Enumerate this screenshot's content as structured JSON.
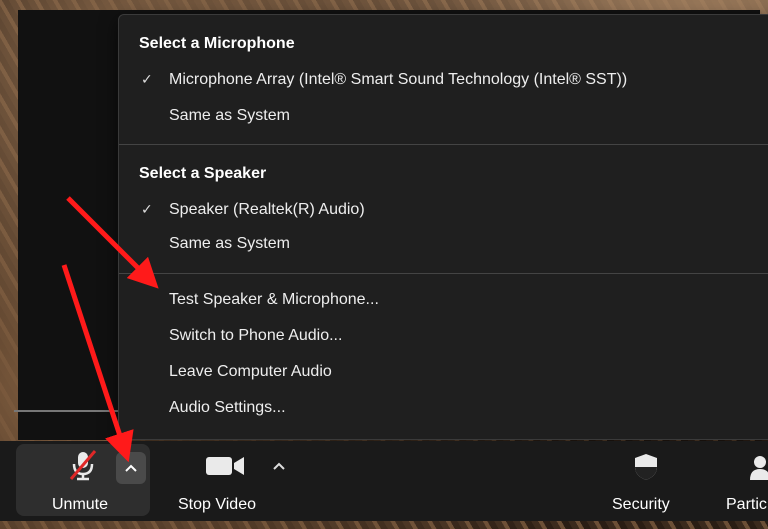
{
  "audio_menu": {
    "microphone_section": {
      "title": "Select a Microphone",
      "items": [
        {
          "label": "Microphone Array (Intel® Smart Sound Technology (Intel® SST))",
          "checked": true
        },
        {
          "label": "Same as System",
          "checked": false
        }
      ]
    },
    "speaker_section": {
      "title": "Select a Speaker",
      "items": [
        {
          "label": "Speaker (Realtek(R) Audio)",
          "checked": true
        },
        {
          "label": "Same as System",
          "checked": false
        }
      ]
    },
    "actions": [
      {
        "label": "Test Speaker & Microphone..."
      },
      {
        "label": "Switch to Phone Audio..."
      },
      {
        "label": "Leave Computer Audio"
      },
      {
        "label": "Audio Settings..."
      }
    ],
    "check_glyph": "✓"
  },
  "toolbar": {
    "unmute_label": "Unmute",
    "stop_video_label": "Stop Video",
    "security_label": "Security",
    "participants_label": "Partic"
  },
  "colors": {
    "menu_bg": "#1f1f1f",
    "arrow": "#ff1a1a"
  }
}
